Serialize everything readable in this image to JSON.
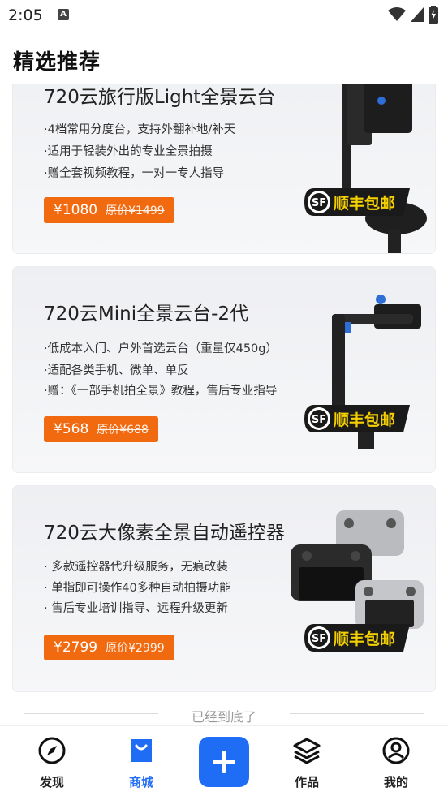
{
  "status_bar": {
    "time": "2:05",
    "notification": "A"
  },
  "header": {
    "title": "精选推荐"
  },
  "products": [
    {
      "title": "720云旅行版Light全景云台",
      "features": [
        "·4档常用分度台，支持外翻补地/补天",
        "·适用于轻装外出的专业全景拍摄",
        "·赠全套视频教程，一对一专人指导"
      ],
      "price": "¥1080",
      "original_price": "原价¥1499",
      "badge": "顺丰包邮"
    },
    {
      "title": "720云Mini全景云台-2代",
      "features": [
        "·低成本入门、户外首选云台（重量仅450g）",
        "·适配各类手机、微单、单反",
        "·赠：《一部手机拍全景》教程，售后专业指导"
      ],
      "price": "¥568",
      "original_price": "原价¥688",
      "badge": "顺丰包邮"
    },
    {
      "title": "720云大像素全景自动遥控器",
      "features": [
        "· 多款遥控器代升级服务，无痕改装",
        "· 单指即可操作40多种自动拍摄功能",
        "· 售后专业培训指导、远程升级更新"
      ],
      "price": "¥2799",
      "original_price": "原价¥2999",
      "badge": "顺丰包邮"
    }
  ],
  "end_note": "已经到底了",
  "tabbar": {
    "items": [
      {
        "label": "发现",
        "icon": "compass-icon"
      },
      {
        "label": "商城",
        "icon": "shopping-bag-icon"
      },
      {
        "label": "作品",
        "icon": "layers-icon"
      },
      {
        "label": "我的",
        "icon": "user-icon"
      }
    ],
    "add_icon": "plus-icon"
  },
  "colors": {
    "accent": "#1f6cf5",
    "price_tag": "#f26a10",
    "sf_badge": "#1a1a1a",
    "sf_text": "#f5d000"
  }
}
